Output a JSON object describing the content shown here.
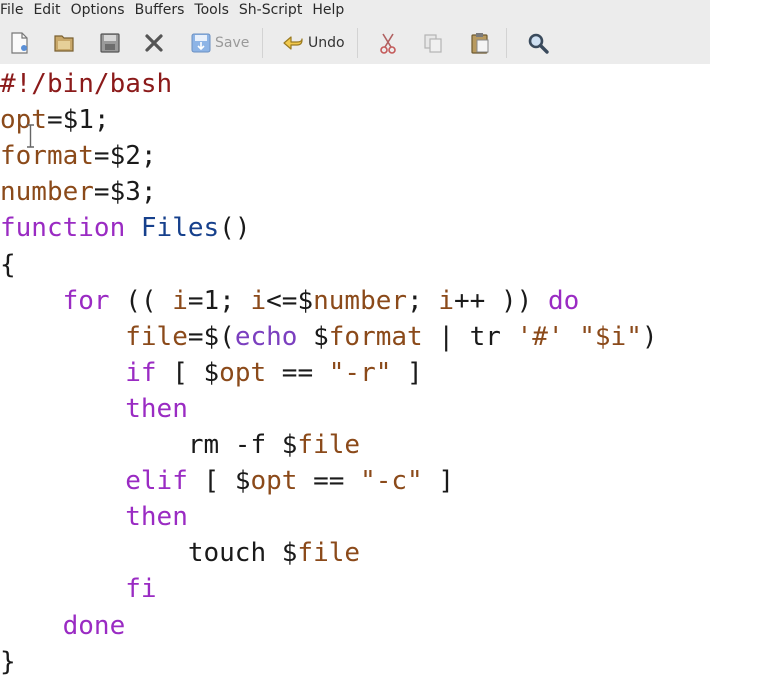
{
  "menubar": {
    "items": [
      "File",
      "Edit",
      "Options",
      "Buffers",
      "Tools",
      "Sh-Script",
      "Help"
    ]
  },
  "toolbar": {
    "save_label": "Save",
    "undo_label": "Undo",
    "icons": [
      "new-file-icon",
      "open-folder-icon",
      "save-floppy-icon",
      "close-x-icon",
      "save-icon",
      "undo-icon",
      "cut-scissors-icon",
      "copy-icon",
      "paste-clipboard-icon",
      "search-magnifier-icon"
    ]
  },
  "colors": {
    "keyword": "#9a2bc3",
    "variable": "#8b4a1a",
    "function_name": "#16408c",
    "shebang": "#8b1a1a",
    "text": "#1a1a1a",
    "toolbar_bg": "#ececec"
  },
  "editor": {
    "lines": [
      [
        {
          "t": "#!/bin/bash",
          "c": "sb"
        }
      ],
      [
        {
          "t": "opt",
          "c": "var"
        },
        {
          "t": "=$1;",
          "c": ""
        }
      ],
      [
        {
          "t": "format",
          "c": "var"
        },
        {
          "t": "=$2;",
          "c": ""
        }
      ],
      [
        {
          "t": "number",
          "c": "var"
        },
        {
          "t": "=$3;",
          "c": ""
        }
      ],
      [
        {
          "t": "function",
          "c": "kw"
        },
        {
          "t": " ",
          "c": ""
        },
        {
          "t": "Files",
          "c": "fn"
        },
        {
          "t": "()",
          "c": ""
        }
      ],
      [
        {
          "t": "{",
          "c": ""
        }
      ],
      [
        {
          "t": "    ",
          "c": ""
        },
        {
          "t": "for",
          "c": "kw"
        },
        {
          "t": " (( ",
          "c": ""
        },
        {
          "t": "i",
          "c": "var"
        },
        {
          "t": "=1; ",
          "c": ""
        },
        {
          "t": "i",
          "c": "var"
        },
        {
          "t": "<=$",
          "c": ""
        },
        {
          "t": "number",
          "c": "var"
        },
        {
          "t": "; ",
          "c": ""
        },
        {
          "t": "i",
          "c": "var"
        },
        {
          "t": "++ )) ",
          "c": ""
        },
        {
          "t": "do",
          "c": "kw"
        }
      ],
      [
        {
          "t": "        ",
          "c": ""
        },
        {
          "t": "file",
          "c": "var"
        },
        {
          "t": "=$(",
          "c": ""
        },
        {
          "t": "echo",
          "c": "cmd"
        },
        {
          "t": " $",
          "c": ""
        },
        {
          "t": "format",
          "c": "var"
        },
        {
          "t": " | tr ",
          "c": ""
        },
        {
          "t": "'#'",
          "c": "str"
        },
        {
          "t": " ",
          "c": ""
        },
        {
          "t": "\"$",
          "c": "str"
        },
        {
          "t": "i",
          "c": "var"
        },
        {
          "t": "\"",
          "c": "str"
        },
        {
          "t": ")",
          "c": ""
        }
      ],
      [
        {
          "t": "        ",
          "c": ""
        },
        {
          "t": "if",
          "c": "kw"
        },
        {
          "t": " [ $",
          "c": ""
        },
        {
          "t": "opt",
          "c": "var"
        },
        {
          "t": " == ",
          "c": ""
        },
        {
          "t": "\"-r\"",
          "c": "str"
        },
        {
          "t": " ]",
          "c": ""
        }
      ],
      [
        {
          "t": "        ",
          "c": ""
        },
        {
          "t": "then",
          "c": "kw"
        }
      ],
      [
        {
          "t": "            rm -f $",
          "c": ""
        },
        {
          "t": "file",
          "c": "var"
        }
      ],
      [
        {
          "t": "        ",
          "c": ""
        },
        {
          "t": "elif",
          "c": "kw"
        },
        {
          "t": " [ $",
          "c": ""
        },
        {
          "t": "opt",
          "c": "var"
        },
        {
          "t": " == ",
          "c": ""
        },
        {
          "t": "\"-c\"",
          "c": "str"
        },
        {
          "t": " ]",
          "c": ""
        }
      ],
      [
        {
          "t": "        ",
          "c": ""
        },
        {
          "t": "then",
          "c": "kw"
        }
      ],
      [
        {
          "t": "            touch $",
          "c": ""
        },
        {
          "t": "file",
          "c": "var"
        }
      ],
      [
        {
          "t": "        ",
          "c": ""
        },
        {
          "t": "fi",
          "c": "kw"
        }
      ],
      [
        {
          "t": "    ",
          "c": ""
        },
        {
          "t": "done",
          "c": "kw"
        }
      ],
      [
        {
          "t": "}",
          "c": ""
        }
      ]
    ]
  }
}
